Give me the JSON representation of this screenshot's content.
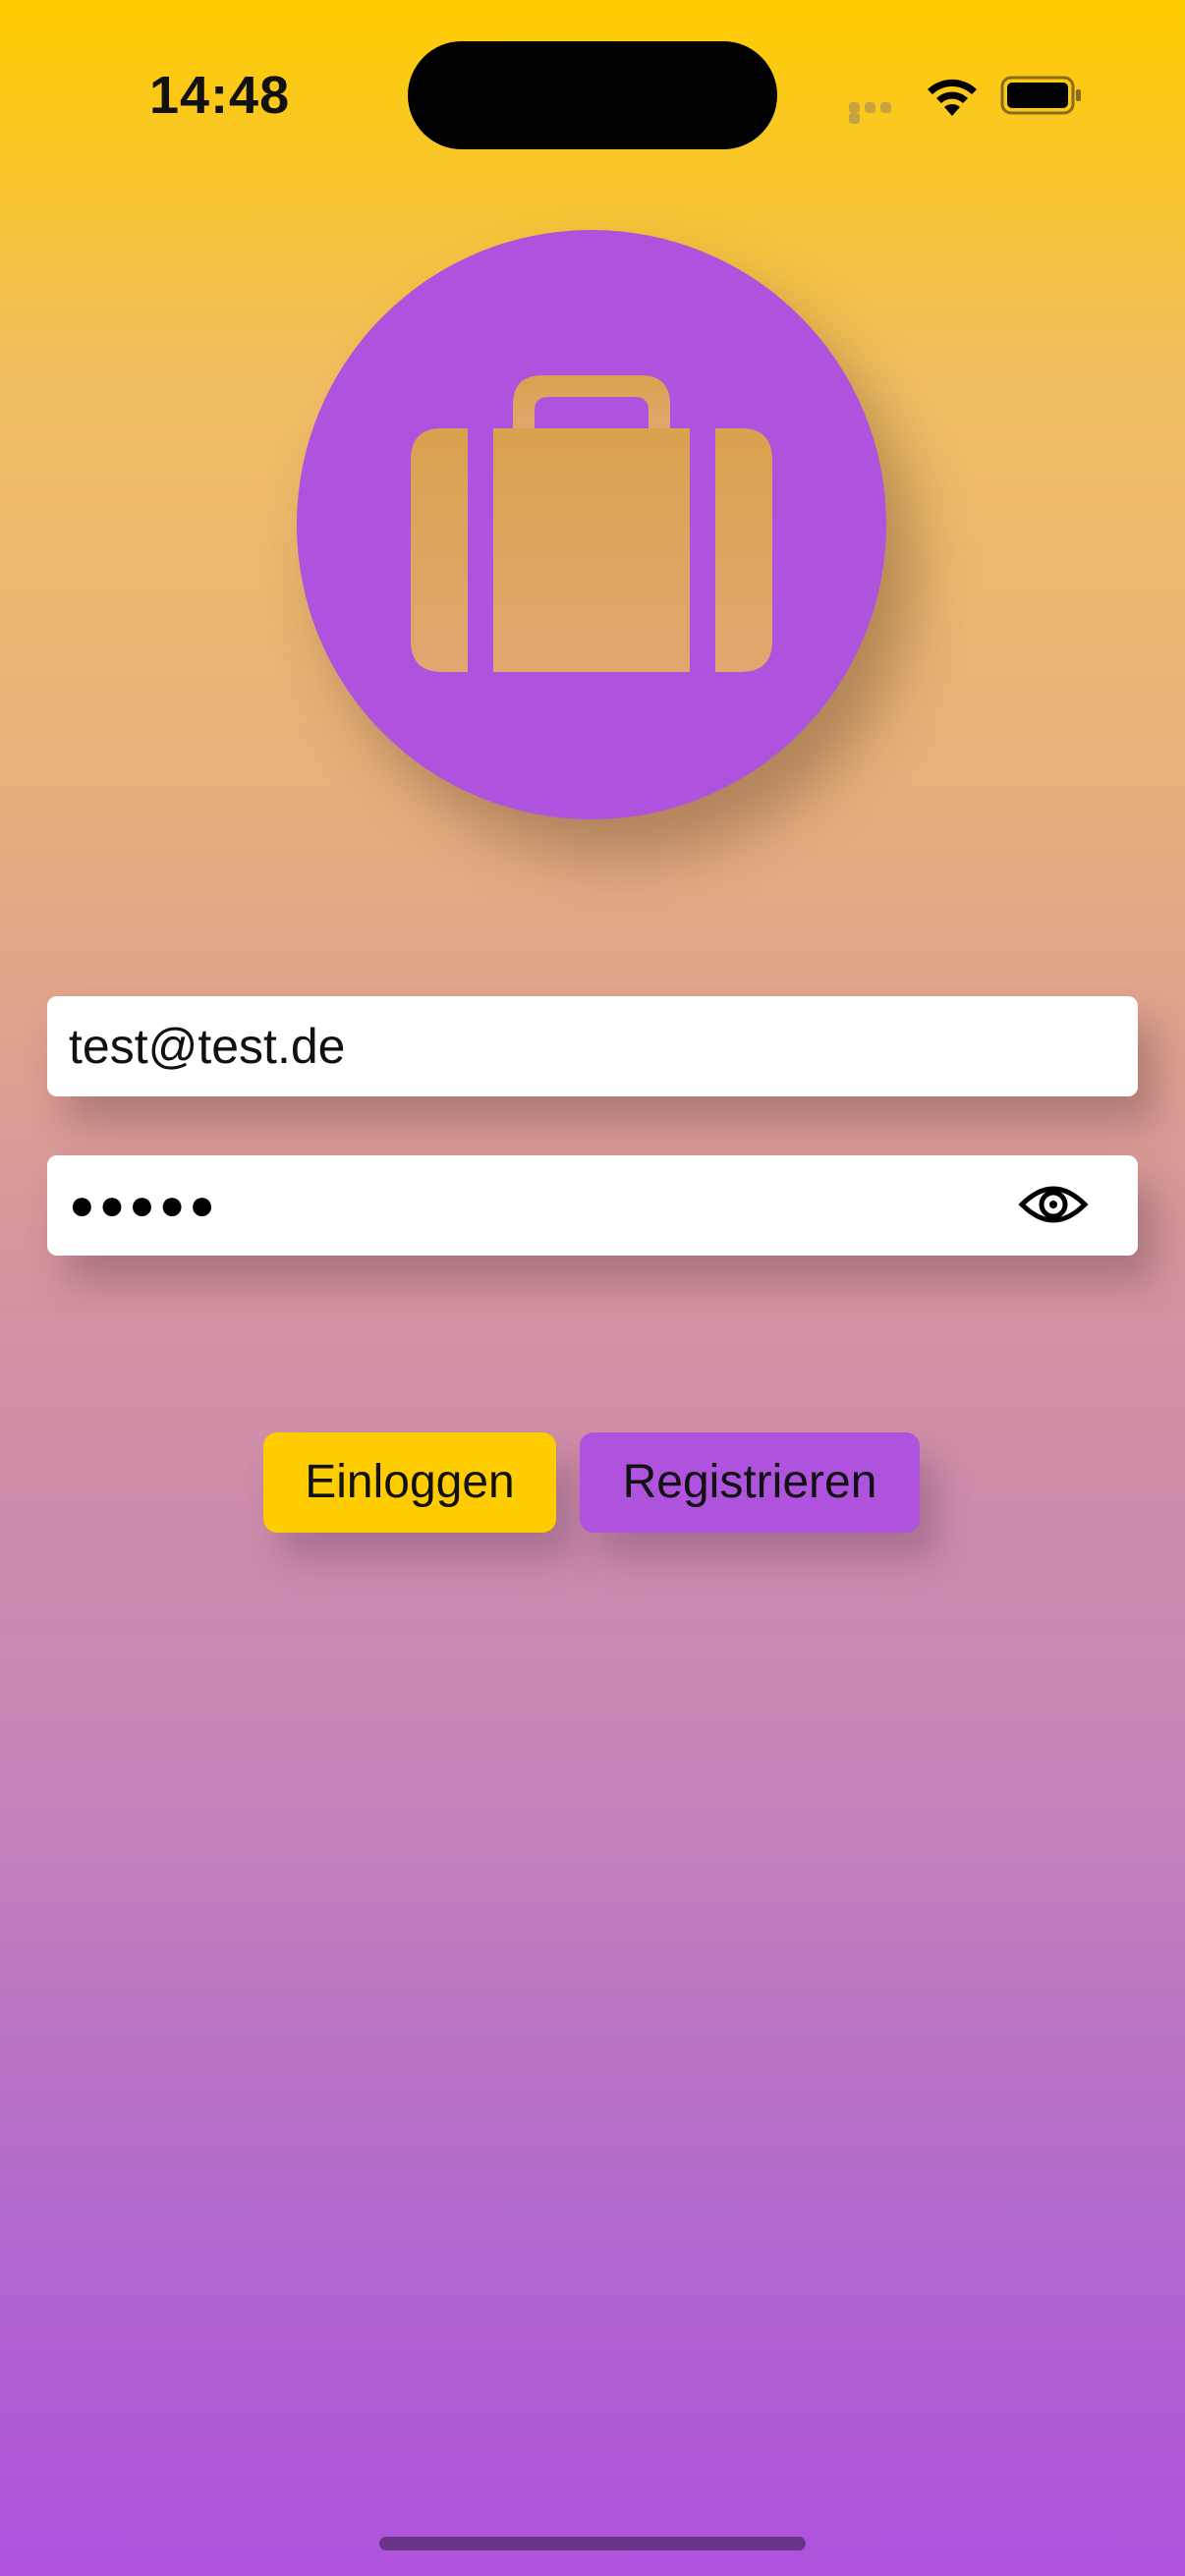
{
  "status_bar": {
    "time": "14:48",
    "icons": [
      "cellular-signal-icon",
      "wifi-icon",
      "battery-icon"
    ]
  },
  "logo": {
    "icon": "briefcase-icon",
    "circle_color": "#AF52DE"
  },
  "login_form": {
    "email_value": "test@test.de",
    "password_masked": "●●●●●",
    "password_toggle_icon": "eye-icon"
  },
  "buttons": {
    "login_label": "Einloggen",
    "register_label": "Registrieren",
    "login_color": "#FFCC00",
    "register_color": "#AF52DE"
  },
  "colors": {
    "gradient_top": "#FFCC00",
    "gradient_bottom": "#AF52DE"
  }
}
